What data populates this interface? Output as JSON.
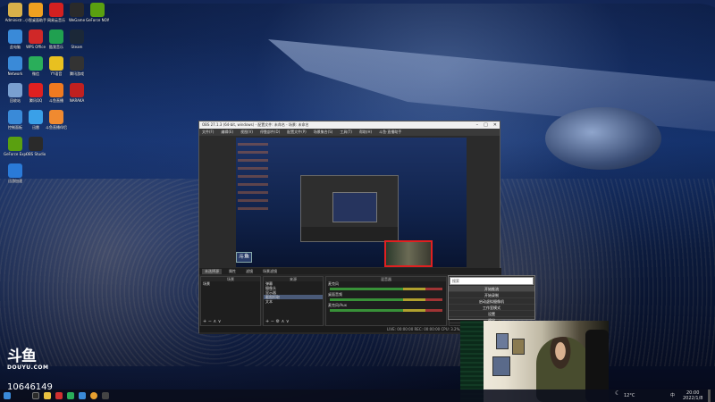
{
  "desktop_icons": [
    {
      "id": "admin",
      "label": "Administr...",
      "color": "#d8b04a"
    },
    {
      "id": "xiaozhi",
      "label": "小智桌面助手",
      "color": "#f0a020"
    },
    {
      "id": "netease",
      "label": "网易云音乐",
      "color": "#d32020"
    },
    {
      "id": "wegame",
      "label": "WeGame",
      "color": "#2a2a2a"
    },
    {
      "id": "geforce-now",
      "label": "GeForce NOW",
      "color": "#5aa010"
    },
    {
      "id": "computer",
      "label": "此电脑",
      "color": "#3a8ad8"
    },
    {
      "id": "wps",
      "label": "WPS Office",
      "color": "#d02828"
    },
    {
      "id": "music2",
      "label": "酷我音乐",
      "color": "#20a050"
    },
    {
      "id": "steam",
      "label": "Steam",
      "color": "#1b2838"
    },
    {
      "id": "network",
      "label": "Network",
      "color": "#3a8ad8"
    },
    {
      "id": "wechat",
      "label": "微信",
      "color": "#2aae5a"
    },
    {
      "id": "app3",
      "label": "YY语音",
      "color": "#e8c020"
    },
    {
      "id": "app4",
      "label": "腾讯游戏",
      "color": "#333333"
    },
    {
      "id": "recycle",
      "label": "回收站",
      "color": "#7aa0d0"
    },
    {
      "id": "app5",
      "label": "腾讯QQ",
      "color": "#e02020"
    },
    {
      "id": "app6",
      "label": "斗鱼直播",
      "color": "#f07a20"
    },
    {
      "id": "naraka",
      "label": "NARAKA",
      "color": "#c02020"
    },
    {
      "id": "control",
      "label": "控制面板",
      "color": "#3a8ad8"
    },
    {
      "id": "app7",
      "label": "迅雷",
      "color": "#3aa0e8"
    },
    {
      "id": "app8",
      "label": "斗鱼直播伴侣",
      "color": "#f08a30"
    },
    {
      "id": "geforce-exp",
      "label": "GeForce Experience",
      "color": "#5aa010"
    },
    {
      "id": "obs",
      "label": "OBS Studio",
      "color": "#2a2a2a"
    },
    {
      "id": "app9",
      "label": "迅游加速",
      "color": "#2a7ad8"
    }
  ],
  "obs": {
    "title": "OBS 27.1.3 (64-bit, windows) - 配置文件: 未命名 - 场景: 未命名",
    "menu": [
      "文件(F)",
      "编辑(E)",
      "视图(V)",
      "停靠部件(D)",
      "配置文件(P)",
      "场景集合(S)",
      "工具(T)",
      "帮助(H)",
      "斗鱼·直播助手"
    ],
    "tabs": {
      "source_props": "属性",
      "filters": "滤镜",
      "scene_filter": "场景滤镜"
    },
    "scenes_header": "场景",
    "scenes": [
      "场景"
    ],
    "sources_header": "来源",
    "sources": [
      "弹幕",
      "摄像头",
      "显示器",
      "截图抓取",
      "文本"
    ],
    "mixer_header": "混音器",
    "mixer": [
      {
        "name": "麦克风",
        "db": "0.0 dB"
      },
      {
        "name": "桌面音频",
        "db": "0.0 dB"
      },
      {
        "name": "麦克风/Aux",
        "db": "0.0 dB"
      }
    ],
    "status": "LIVE: 00:00:00  REC: 00:00:00  CPU: 3.2%, 30.00 fps"
  },
  "context_menu": {
    "search_placeholder": "搜索",
    "items": [
      "开始推流",
      "开始录制",
      "启动虚拟摄像机",
      "工作室模式",
      "设置",
      "退出"
    ]
  },
  "watermark": {
    "logo": "斗鱼",
    "site": "DOUYU.COM",
    "room": "10646149"
  },
  "taskbar": {
    "temp": "12°C",
    "ime": "中",
    "time": "20:00",
    "date": "2022/1/8"
  }
}
